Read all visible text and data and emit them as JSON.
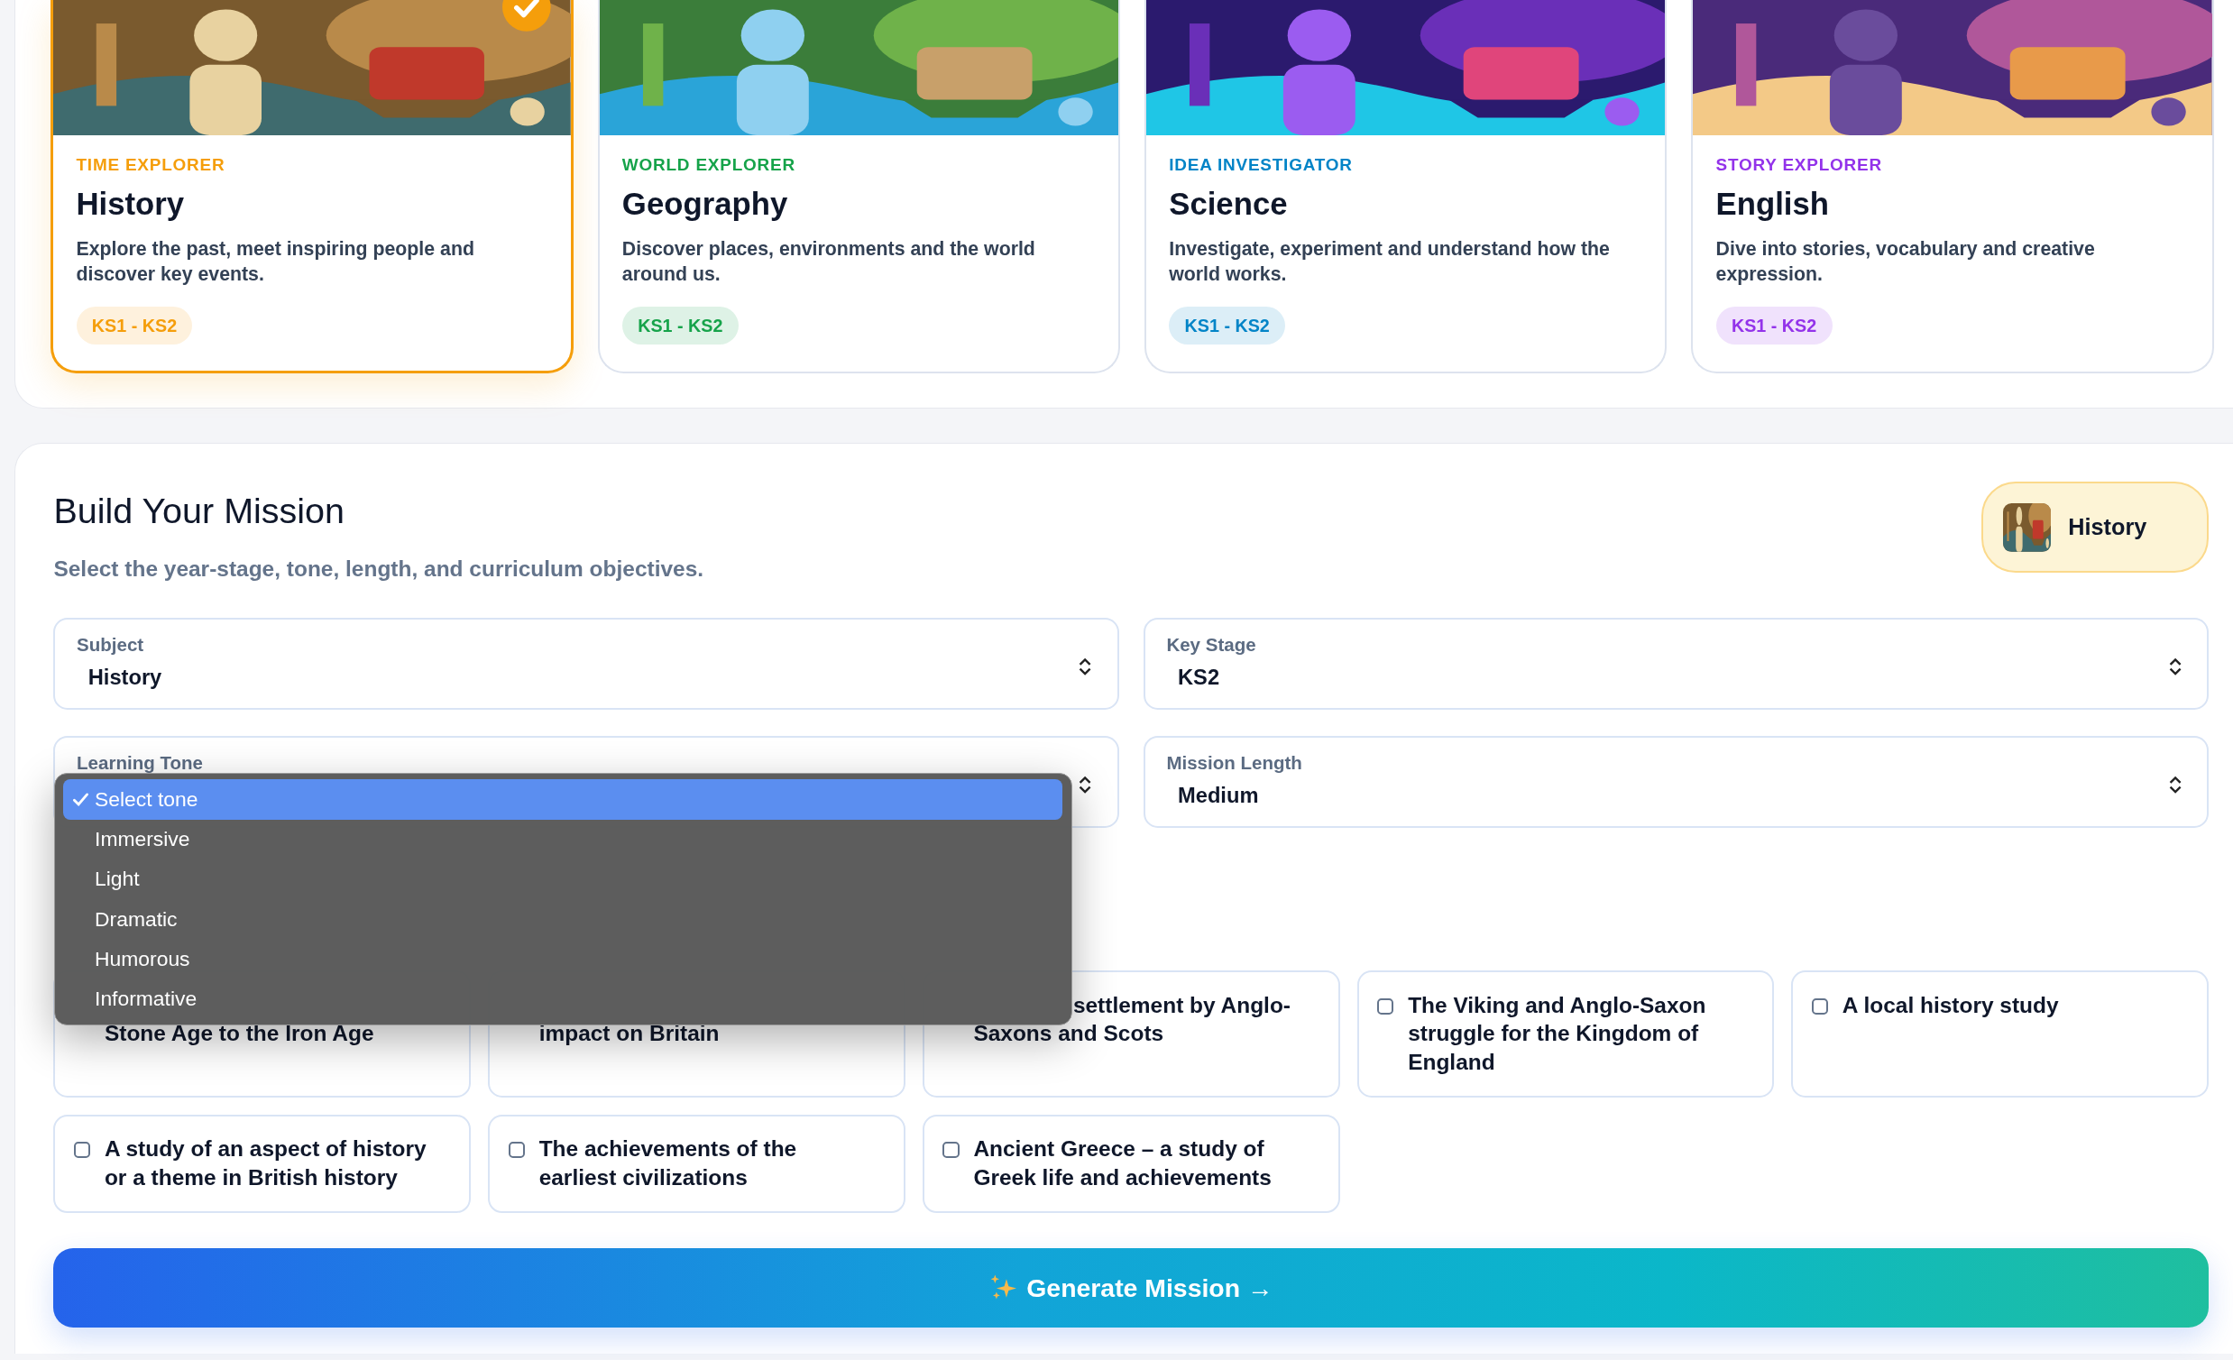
{
  "subjects": [
    {
      "role": "TIME EXPLORER",
      "title": "History",
      "description": "Explore the past, meet inspiring people and discover key events.",
      "tag": "KS1 - KS2",
      "color": "#f59e0b",
      "selected": true
    },
    {
      "role": "WORLD EXPLORER",
      "title": "Geography",
      "description": "Discover places, environments and the world around us.",
      "tag": "KS1 - KS2",
      "color": "#16a34a",
      "selected": false
    },
    {
      "role": "IDEA INVESTIGATOR",
      "title": "Science",
      "description": "Investigate, experiment and understand how the world works.",
      "tag": "KS1 - KS2",
      "color": "#0284c7",
      "selected": false
    },
    {
      "role": "STORY EXPLORER",
      "title": "English",
      "description": "Dive into stories, vocabulary and creative expression.",
      "tag": "KS1 - KS2",
      "color": "#9333ea",
      "selected": false
    }
  ],
  "mission": {
    "title": "Build Your Mission",
    "subtitle": "Select the year-stage, tone, length, and curriculum objectives.",
    "current_subject": "History",
    "fields": [
      {
        "label": "Subject",
        "value": "History"
      },
      {
        "label": "Key Stage",
        "value": "KS2"
      },
      {
        "label": "Learning Tone",
        "open": true,
        "options": [
          {
            "label": "Select tone",
            "selected": true
          },
          {
            "label": "Immersive",
            "selected": false
          },
          {
            "label": "Light",
            "selected": false
          },
          {
            "label": "Dramatic",
            "selected": false
          },
          {
            "label": "Humorous",
            "selected": false
          },
          {
            "label": "Informative",
            "selected": false
          }
        ]
      },
      {
        "label": "Mission Length",
        "value": "Medium"
      }
    ],
    "objectives": [
      {
        "kind": "covered-line",
        "label": "Stone Age to the Iron Age"
      },
      {
        "kind": "covered-line",
        "label": "impact on Britain"
      },
      {
        "kind": "covered-start",
        "label": "settlement by Anglo-Saxons and Scots"
      },
      {
        "kind": "checkbox",
        "label": "The Viking and Anglo-Saxon struggle for the Kingdom of England",
        "checked": false
      },
      {
        "kind": "checkbox",
        "label": "A local history study",
        "checked": false
      },
      {
        "kind": "checkbox",
        "label": "A study of an aspect of history or a theme in British history",
        "checked": false
      },
      {
        "kind": "checkbox",
        "label": "The achievements of the earliest civilizations",
        "checked": false
      },
      {
        "kind": "checkbox",
        "label": "Ancient Greece – a study of Greek life and achievements",
        "checked": false
      }
    ],
    "generate_button": "Generate Mission →"
  }
}
